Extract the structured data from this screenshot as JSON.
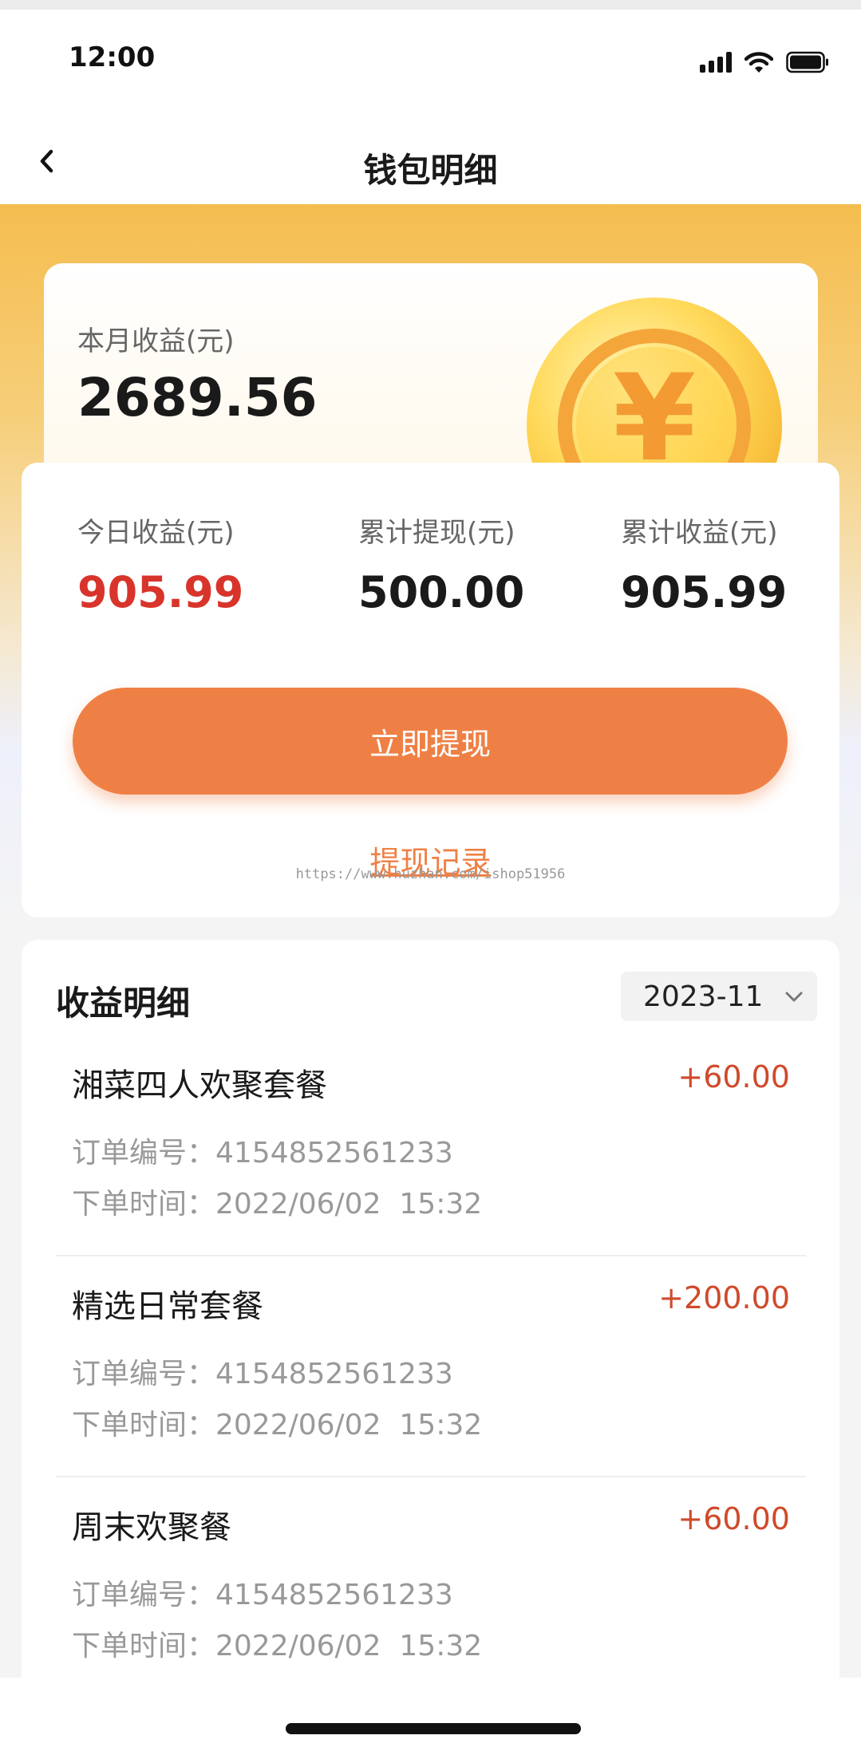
{
  "status_bar": {
    "time": "12:00"
  },
  "nav": {
    "title": "钱包明细"
  },
  "month_card": {
    "label": "本月收益(元)",
    "value": "2689.56",
    "coin_symbol": "¥"
  },
  "stats": [
    {
      "label": "今日收益(元)",
      "value": "905.99",
      "color": "#d8342b"
    },
    {
      "label": "累计提现(元)",
      "value": "500.00"
    },
    {
      "label": "累计收益(元)",
      "value": "905.99"
    }
  ],
  "withdraw_button": "立即提现",
  "withdraw_records_link": "提现记录",
  "watermark": "https://www.huzhan.com/ishop51956",
  "income": {
    "title": "收益明细",
    "selected_month": "2023-11",
    "items": [
      {
        "name": "湘菜四人欢聚套餐",
        "amount": "+60.00",
        "order_no": "订单编号：4154852561233",
        "order_time": "下单时间：2022/06/02  15:32"
      },
      {
        "name": "精选日常套餐",
        "amount": "+200.00",
        "order_no": "订单编号：4154852561233",
        "order_time": "下单时间：2022/06/02  15:32"
      },
      {
        "name": "周末欢聚餐",
        "amount": "+60.00",
        "order_no": "订单编号：4154852561233",
        "order_time": "下单时间：2022/06/02  15:32"
      }
    ]
  },
  "colors": {
    "accent": "#ef8045",
    "highlight": "#d8342b",
    "amount": "#cf4a2a",
    "hero": "#f5bd4f"
  }
}
